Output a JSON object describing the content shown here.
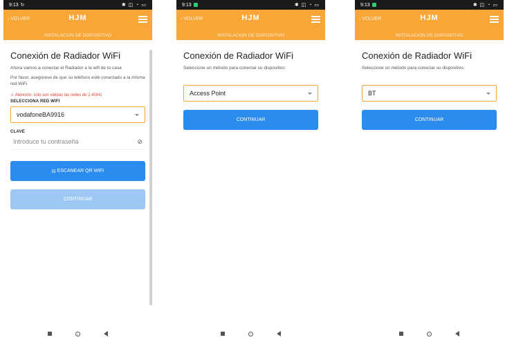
{
  "status": {
    "time": "9:13",
    "right_icons": "✱ ◫ ◔ ▭"
  },
  "app": {
    "back_label": "VOLVER",
    "logo": "HJM",
    "section": "INSTALACIÓN DE DISPOSITIVO"
  },
  "screen1": {
    "title": "Conexión de Radiador WiFi",
    "text1": "Ahora vamos a conectar el Radiador a la wifi de tu casa",
    "text2": "Por favor, asegúrese de que su teléfono esté conectado a la misma red WiFi",
    "warning": "Atención: solo son válidas las redes de 2.4GHz",
    "wifi_label": "SELECCIONA RED WIFI",
    "wifi_value": "vodafoneBA9916",
    "pwd_label": "CLAVE",
    "pwd_placeholder": "Introduce tu contraseña",
    "scan_button": "ESCANEAR QR WIFI",
    "continue": "CONTINUAR"
  },
  "screen2": {
    "title": "Conexión de Radiador WiFi",
    "text": "Seleccione un método para conectar su dispositivo",
    "method": "Access Point",
    "continue": "CONTINUAR"
  },
  "screen3": {
    "title": "Conexión de Radiador WiFi",
    "text": "Seleccione un método para conectar su dispositivo.",
    "method": "BT",
    "continue": "CONTINUAR"
  },
  "colors": {
    "accent": "#f7a637",
    "button": "#2b8cef",
    "button_disabled": "#9cc8f3"
  },
  "icons": [
    "back-chevron-icon",
    "menu-icon",
    "warning-icon",
    "dropdown-caret-icon",
    "eye-off-icon",
    "qr-scan-icon",
    "nav-recents-icon",
    "nav-home-icon",
    "nav-back-icon"
  ]
}
